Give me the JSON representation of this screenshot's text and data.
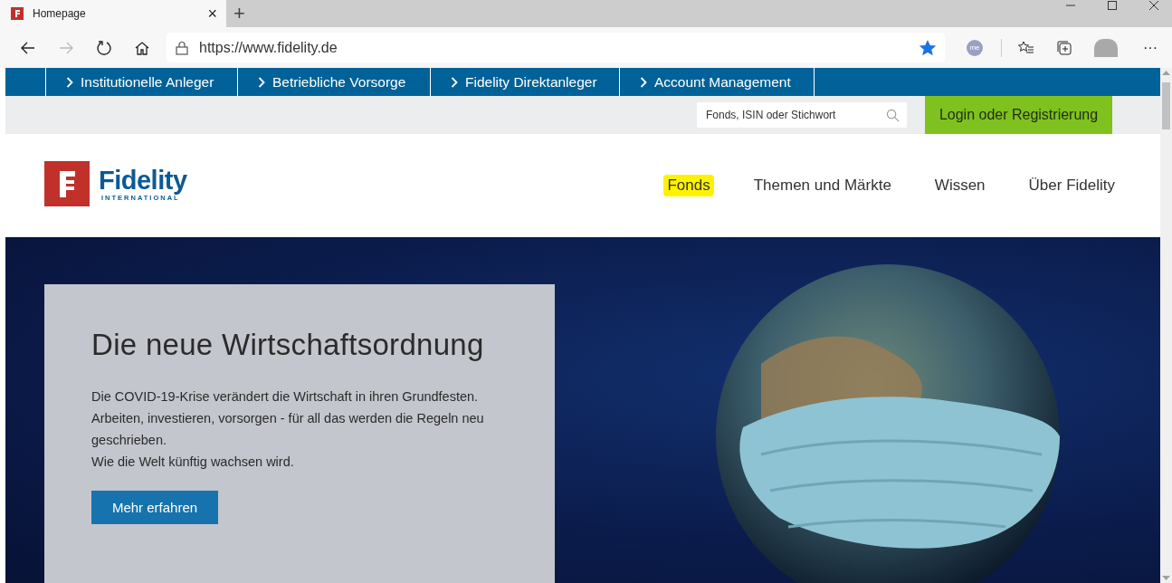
{
  "browser": {
    "tab": {
      "title": "Homepage",
      "close": "×"
    },
    "new_tab": "+",
    "address": "https://www.fidelity.de",
    "bookmarked": true,
    "extension_label": "me",
    "more": "···"
  },
  "audience_nav": [
    {
      "label": "Institutionelle Anleger"
    },
    {
      "label": "Betriebliche Vorsorge"
    },
    {
      "label": "Fidelity Direktanleger"
    },
    {
      "label": "Account Management"
    }
  ],
  "search": {
    "placeholder": "Fonds, ISIN oder Stichwort"
  },
  "login_button": "Login oder Registrierung",
  "logo": {
    "name": "Fidelity",
    "subtitle": "INTERNATIONAL"
  },
  "main_nav": [
    {
      "label": "Fonds",
      "highlighted": true
    },
    {
      "label": "Themen und Märkte",
      "highlighted": false
    },
    {
      "label": "Wissen",
      "highlighted": false
    },
    {
      "label": "Über Fidelity",
      "highlighted": false
    }
  ],
  "hero": {
    "title": "Die neue Wirtschaftsordnung",
    "paragraphs": [
      "Die COVID-19-Krise verändert die Wirtschaft in ihren Grundfesten. Arbeiten, investieren, vorsorgen - für all das werden die Regeln neu geschrieben.",
      "Wie die Welt künftig wachsen wird."
    ],
    "button": "Mehr erfahren"
  }
}
